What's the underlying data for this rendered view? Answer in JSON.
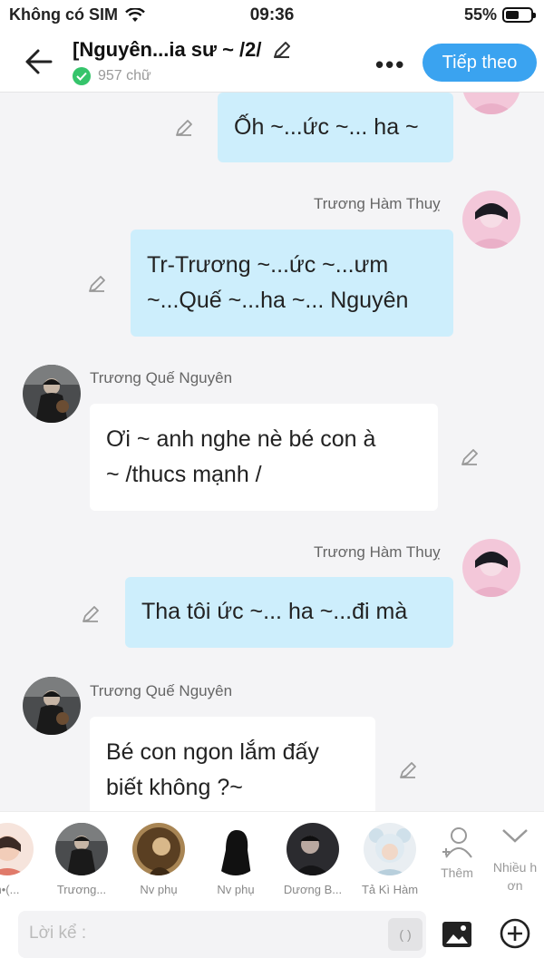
{
  "status_bar": {
    "carrier": "Không có SIM",
    "time": "09:36",
    "battery": "55%",
    "battery_level": 0.55
  },
  "header": {
    "title": "[Nguyên...ia sư ~ /2/",
    "word_count": "957 chữ",
    "next_label": "Tiếp theo"
  },
  "messages": [
    {
      "side": "right",
      "text": "Ốh ~...ức ~... ha ~"
    },
    {
      "side": "right",
      "name": "Trương Hàm Thuỵ",
      "lines": [
        "Tr-Trương ~...ức ~...ưm",
        "~...Quế ~...ha ~... Nguyên"
      ]
    },
    {
      "side": "left",
      "name": "Trương Quế Nguyên",
      "lines": [
        "Ơi ~ anh nghe nè bé con à",
        "~ /thucs mạnh /"
      ]
    },
    {
      "side": "right",
      "name": "Trương Hàm Thuỵ",
      "text": "Tha tôi ức ~... ha ~...đi mà"
    },
    {
      "side": "left",
      "name": "Trương Quế Nguyên",
      "lines": [
        "Bé con ngon lắm đấy",
        "biết không ?~"
      ]
    }
  ],
  "characters": [
    {
      "label": "n•(..."
    },
    {
      "label": "Trương..."
    },
    {
      "label": "Nv phụ"
    },
    {
      "label": "Nv phụ"
    },
    {
      "label": "Dương B..."
    },
    {
      "label": "Tả Kì Hàm"
    }
  ],
  "tools": {
    "add_label": "Thêm",
    "more_label_1": "Nhiều h",
    "more_label_2": "ơn"
  },
  "composer": {
    "placeholder": "Lời kể :",
    "paren_label": "( )"
  },
  "colors": {
    "accent": "#3aa3f0",
    "right_bubble": "#cdeefc",
    "left_bubble": "#ffffff",
    "verified": "#35c46b"
  }
}
